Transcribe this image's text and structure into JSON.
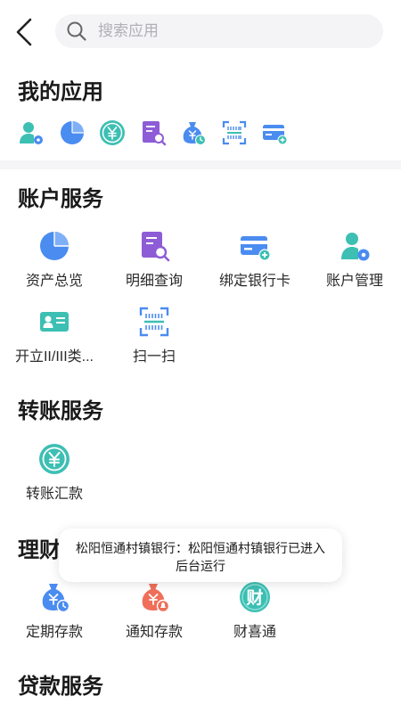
{
  "search": {
    "placeholder": "搜索应用"
  },
  "my_apps": {
    "title": "我的应用",
    "icons": [
      "user-settings-icon",
      "pie-chart-icon",
      "yuan-coin-icon",
      "document-search-icon",
      "money-bag-clock-icon",
      "scan-icon",
      "bank-card-add-icon"
    ]
  },
  "account_services": {
    "title": "账户服务",
    "items": [
      {
        "label": "资产总览",
        "icon": "pie-chart-icon"
      },
      {
        "label": "明细查询",
        "icon": "document-search-icon"
      },
      {
        "label": "绑定银行卡",
        "icon": "bank-card-add-icon"
      },
      {
        "label": "账户管理",
        "icon": "user-settings-icon"
      },
      {
        "label": "开立II/III类...",
        "icon": "id-card-icon"
      },
      {
        "label": "扫一扫",
        "icon": "scan-icon"
      }
    ]
  },
  "transfer_services": {
    "title": "转账服务",
    "items": [
      {
        "label": "转账汇款",
        "icon": "yuan-coin-icon"
      }
    ]
  },
  "wealth_services": {
    "title": "理财",
    "items": [
      {
        "label": "定期存款",
        "icon": "money-bag-clock-icon"
      },
      {
        "label": "通知存款",
        "icon": "money-bag-bell-icon"
      },
      {
        "label": "财喜通",
        "icon": "cai-badge-icon",
        "glyph": "财"
      }
    ]
  },
  "loan_services": {
    "title": "贷款服务"
  },
  "toast": {
    "text": "松阳恒通村镇银行：松阳恒通村镇银行已进入后台运行"
  },
  "colors": {
    "teal": "#3dbfb3",
    "blue": "#4a8cf0",
    "purple": "#8e5cd6",
    "coral": "#ef6f5a"
  }
}
